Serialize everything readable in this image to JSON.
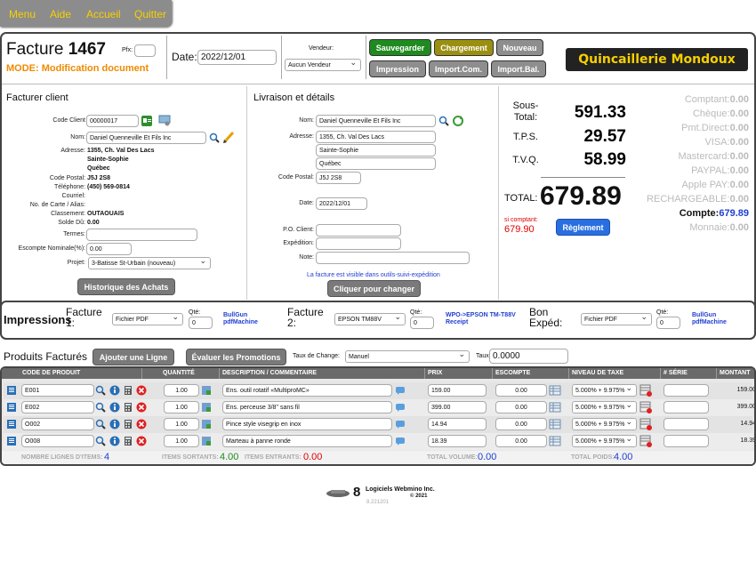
{
  "nav": {
    "menu": "Menu",
    "aide": "Aide",
    "accueil": "Accueil",
    "quitter": "Quitter"
  },
  "header": {
    "facture_label": "Facture",
    "facture_num": "1467",
    "pfx_label": "Pfx:",
    "mode": "MODE: Modification document",
    "date_label": "Date:",
    "date_value": "2022/12/01",
    "vendeur_label": "Vendeur:",
    "vendeur_value": "Aucun Vendeur",
    "btn_sauvegarder": "Sauvegarder",
    "btn_chargement": "Chargement",
    "btn_nouveau": "Nouveau",
    "btn_impression": "Impression",
    "btn_import_com": "Import.Com.",
    "btn_import_bal": "Import.Bal.",
    "logo_text": "Quincaillerie Mondoux"
  },
  "client": {
    "title": "Facturer client",
    "code_label": "Code Client",
    "code_value": "00000017",
    "nom_label": "Nom:",
    "nom_value": "Daniel Quenneville Et Fils Inc",
    "adresse_label": "Adresse:",
    "adresse_l1": "1355, Ch. Val Des Lacs",
    "adresse_l2": "Sainte-Sophie",
    "adresse_l3": "Québec",
    "cp_label": "Code Postal:",
    "cp_value": "J5J 2S8",
    "tel_label": "Téléphone:",
    "tel_value": "(450) 569-0814",
    "courriel_label": "Courriel:",
    "carte_label": "No. de Carte / Alias:",
    "classement_label": "Classement:",
    "classement_value": "OUTAOUAIS",
    "solde_label": "Solde Dû:",
    "solde_value": "0.00",
    "termes_label": "Termes:",
    "escompte_label": "Escompte Nominale(%):",
    "escompte_value": "0.00",
    "projet_label": "Projet:",
    "projet_value": "3-Batisse St-Urbain (nouveau)",
    "btn_historique": "Historique des Achats"
  },
  "livraison": {
    "title": "Livraison et détails",
    "nom_label": "Nom:",
    "nom_value": "Daniel Quenneville Et Fils Inc",
    "adresse_label": "Adresse:",
    "adresse_l1": "1355, Ch. Val Des Lacs",
    "adresse_l2": "Sainte-Sophie",
    "adresse_l3": "Québec",
    "cp_label": "Code Postal:",
    "cp_value": "J5J 2S8",
    "date_label": "Date:",
    "date_value": "2022/12/01",
    "po_label": "P.O. Client:",
    "exp_label": "Expédition:",
    "note_label": "Note:",
    "visible_note": "La facture est visible dans outils-suivi-expédition",
    "btn_changer": "Cliquer pour changer"
  },
  "totals": {
    "sous_total_label": "Sous-\nTotal:",
    "sous_total": "591.33",
    "tps_label": "T.P.S.",
    "tps": "29.57",
    "tvq_label": "T.V.Q.",
    "tvq": "58.99",
    "total_label": "TOTAL:",
    "total": "679.89",
    "si_comptant_label": "si comptant:",
    "si_comptant": "679.90",
    "btn_reglement": "Règlement"
  },
  "payments": [
    {
      "label": "Comptant:",
      "value": "0.00",
      "active": false
    },
    {
      "label": "Chèque:",
      "value": "0.00",
      "active": false
    },
    {
      "label": "Pmt.Direct:",
      "value": "0.00",
      "active": false
    },
    {
      "label": "VISA:",
      "value": "0.00",
      "active": false
    },
    {
      "label": "Mastercard:",
      "value": "0.00",
      "active": false
    },
    {
      "label": "PAYPAL:",
      "value": "0.00",
      "active": false
    },
    {
      "label": "Apple PAY:",
      "value": "0.00",
      "active": false
    },
    {
      "label": "RECHARGEABLE:",
      "value": "0.00",
      "active": false
    },
    {
      "label": "Compte:",
      "value": "679.89",
      "active": true
    },
    {
      "label": "Monnaie:",
      "value": "0.00",
      "active": false
    }
  ],
  "impressions": {
    "title": "Impressions",
    "f1_label": "Facture\n1:",
    "f1_select": "Fichier PDF",
    "f1_qte": "0",
    "f1_link": "BullGun\npdfMachine",
    "f2_label": "Facture\n2:",
    "f2_select": "EPSON TM88V",
    "f2_qte": "0",
    "f2_link": "WPO->EPSON TM-T88V\nReceipt",
    "f3_label": "Bon\nExpéd:",
    "f3_select": "Fichier PDF",
    "f3_qte": "0",
    "f3_link": "BullGun\npdfMachine",
    "qte_label": "Qté:"
  },
  "produits": {
    "title": "Produits Facturés",
    "btn_ajouter": "Ajouter une Ligne",
    "btn_promos": "Évaluer les Promotions",
    "taux_change_label": "Taux de Change:",
    "taux_change_value": "Manuel",
    "taux_label": "Taux:",
    "taux_value": "0.0000",
    "columns": [
      "CODE DE PRODUIT",
      "QUANTITÉ",
      "DESCRIPTION / COMMENTAIRE",
      "PRIX",
      "ESCOMPTE",
      "NIVEAU DE TAXE",
      "# SÉRIE",
      "MONTANT"
    ],
    "rows": [
      {
        "code": "E001",
        "qte": "1.00",
        "desc": "Ens. outil rotatif «MultiproMC»",
        "prix": "159.00",
        "escompte": "0.00",
        "taxe": "5.000% + 9.975%",
        "montant": "159.00"
      },
      {
        "code": "E002",
        "qte": "1.00",
        "desc": "Ens. perceuse 3/8'' sans fil",
        "prix": "399.00",
        "escompte": "0.00",
        "taxe": "5.000% + 9.975%",
        "montant": "399.00"
      },
      {
        "code": "O002",
        "qte": "1.00",
        "desc": "Pince style visegrip en inox",
        "prix": "14.94",
        "escompte": "0.00",
        "taxe": "5.000% + 9.975%",
        "montant": "14.94"
      },
      {
        "code": "O008",
        "qte": "1.00",
        "desc": "Marteau à panne ronde",
        "prix": "18.39",
        "escompte": "0.00",
        "taxe": "5.000% + 9.975%",
        "montant": "18.39"
      }
    ],
    "footer": {
      "lignes_label": "NOMBRE LIGNES D'ITEMS:",
      "lignes": "4",
      "sortants_label": "ITEMS SORTANTS:",
      "sortants": "4.00",
      "entrants_label": "ITEMS ENTRANTS:",
      "entrants": "0.00",
      "volume_label": "TOTAL VOLUME:",
      "volume": "0.00",
      "poids_label": "TOTAL POIDS:",
      "poids": "4.00"
    }
  },
  "footer": {
    "company": "Logiciels Webmino Inc.",
    "year": "© 2021",
    "version": "8.221201"
  },
  "colors": {
    "accent_yellow": "#f6d000",
    "green": "#1f8a1f",
    "orange": "#f08a00",
    "blue": "#1f3fd0",
    "red": "#e00000"
  }
}
